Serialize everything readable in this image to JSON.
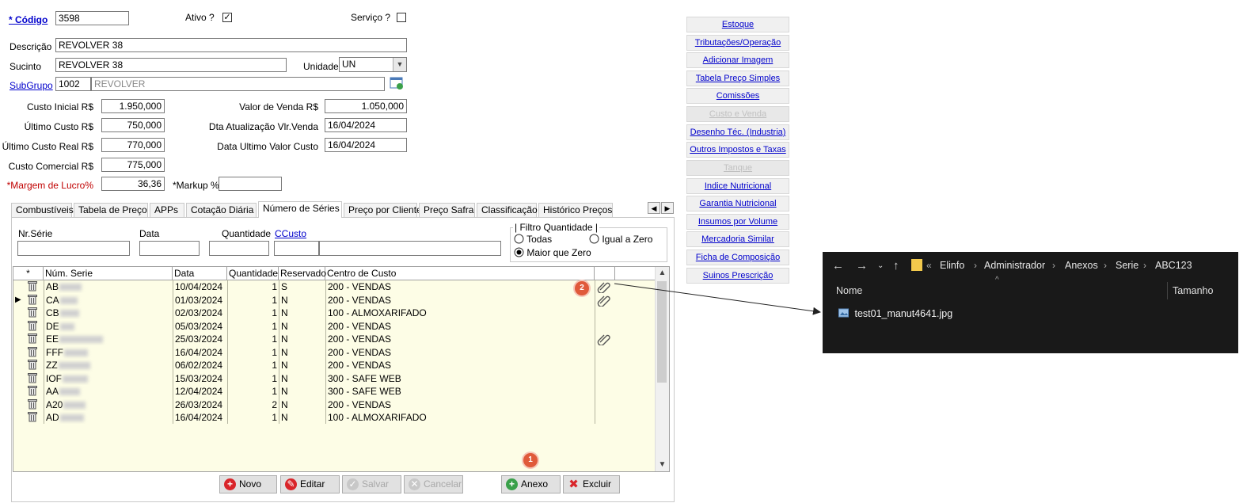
{
  "form": {
    "codigo_label": "* Código",
    "codigo_value": "3598",
    "ativo_label": "Ativo ?",
    "ativo_checked": "✓",
    "servico_label": "Serviço ?",
    "descricao_label": "Descrição",
    "descricao_value": "REVOLVER 38",
    "sucinto_label": "Sucinto",
    "sucinto_value": "REVOLVER 38",
    "unidade_label": "Unidade",
    "unidade_value": "UN",
    "subgrupo_label": "SubGrupo",
    "subgrupo_code": "1002",
    "subgrupo_name": "REVOLVER",
    "custo_inicial_label": "Custo Inicial R$",
    "custo_inicial_value": "1.950,000",
    "ultimo_custo_label": "Último Custo R$",
    "ultimo_custo_value": "750,000",
    "ultimo_custo_real_label": "Último Custo Real R$",
    "ultimo_custo_real_value": "770,000",
    "custo_comercial_label": "Custo Comercial R$",
    "custo_comercial_value": "775,000",
    "margem_label": "*Margem de Lucro%",
    "margem_value": "36,36",
    "markup_label": "*Markup %",
    "markup_value": "",
    "valor_venda_label": "Valor de Venda R$",
    "valor_venda_value": "1.050,000",
    "dta_atualizacao_label": "Dta Atualização Vlr.Venda",
    "dta_atualizacao_value": "16/04/2024",
    "data_ultimo_custo_label": "Data Ultimo Valor Custo",
    "data_ultimo_custo_value": "16/04/2024"
  },
  "side_buttons": [
    {
      "label": "Estoque",
      "disabled": false
    },
    {
      "label": "Tributações/Operação",
      "disabled": false
    },
    {
      "label": "Adicionar Imagem",
      "disabled": false
    },
    {
      "label": "Tabela Preço Simples",
      "disabled": false
    },
    {
      "label": "Comissões",
      "disabled": false
    },
    {
      "label": "Custo e Venda",
      "disabled": true
    },
    {
      "label": "Desenho Téc. (Industria)",
      "disabled": false
    },
    {
      "label": "Outros Impostos e Taxas",
      "disabled": false
    },
    {
      "label": "Tanque",
      "disabled": true
    },
    {
      "label": "Indice Nutricional",
      "disabled": false
    },
    {
      "label": "Garantia Nutricional",
      "disabled": false
    },
    {
      "label": "Insumos por Volume",
      "disabled": false
    },
    {
      "label": "Mercadoria Similar",
      "disabled": false
    },
    {
      "label": "Ficha de Composição",
      "disabled": false
    },
    {
      "label": "Suinos Prescrição",
      "disabled": false
    }
  ],
  "tabs": [
    {
      "label": "Combustíveis"
    },
    {
      "label": "Tabela de Preço"
    },
    {
      "label": "APPs"
    },
    {
      "label": "Cotação Diária"
    },
    {
      "label": "Número de Séries"
    },
    {
      "label": "Preço por Cliente"
    },
    {
      "label": "Preço Safra"
    },
    {
      "label": "Classificação"
    },
    {
      "label": "Histórico Preços"
    }
  ],
  "filters": {
    "nr_serie_label": "Nr.Série",
    "data_label": "Data",
    "quantidade_label": "Quantidade",
    "ccusto_label": "CCusto",
    "filtro_title": "Filtro Quantidade",
    "opt_todas": "Todas",
    "opt_igual_zero": "Igual a Zero",
    "opt_maior_zero": "Maior que Zero"
  },
  "grid": {
    "columns": [
      "*",
      "Núm. Serie",
      "Data",
      "Quantidade",
      "Reservado",
      "Centro de Custo"
    ],
    "rows": [
      {
        "serie": "AB",
        "data": "10/04/2024",
        "qtd": "1",
        "res": "S",
        "cc": "200 - VENDAS",
        "clip": true
      },
      {
        "serie": "CA",
        "data": "01/03/2024",
        "qtd": "1",
        "res": "N",
        "cc": "200 - VENDAS",
        "clip": true
      },
      {
        "serie": "CB",
        "data": "02/03/2024",
        "qtd": "1",
        "res": "N",
        "cc": "100 - ALMOXARIFADO",
        "clip": false
      },
      {
        "serie": "DE",
        "data": "05/03/2024",
        "qtd": "1",
        "res": "N",
        "cc": "200 - VENDAS",
        "clip": false
      },
      {
        "serie": "EE",
        "data": "25/03/2024",
        "qtd": "1",
        "res": "N",
        "cc": "200 - VENDAS",
        "clip": true
      },
      {
        "serie": "FFF",
        "data": "16/04/2024",
        "qtd": "1",
        "res": "N",
        "cc": "200 - VENDAS",
        "clip": false
      },
      {
        "serie": "ZZ",
        "data": "06/02/2024",
        "qtd": "1",
        "res": "N",
        "cc": "200 - VENDAS",
        "clip": false
      },
      {
        "serie": "IOF",
        "data": "15/03/2024",
        "qtd": "1",
        "res": "N",
        "cc": "300 - SAFE WEB",
        "clip": false
      },
      {
        "serie": "AA",
        "data": "12/04/2024",
        "qtd": "1",
        "res": "N",
        "cc": "300 - SAFE WEB",
        "clip": false
      },
      {
        "serie": "A20",
        "data": "26/03/2024",
        "qtd": "2",
        "res": "N",
        "cc": "200 - VENDAS",
        "clip": false
      },
      {
        "serie": "AD",
        "data": "16/04/2024",
        "qtd": "1",
        "res": "N",
        "cc": "100 - ALMOXARIFADO",
        "clip": false
      }
    ]
  },
  "bottom_buttons": {
    "novo": "Novo",
    "editar": "Editar",
    "salvar": "Salvar",
    "cancelar": "Cancelar",
    "anexo": "Anexo",
    "excluir": "Excluir"
  },
  "badges": {
    "one": "1",
    "two": "2"
  },
  "explorer": {
    "breadcrumb": [
      "Elinfo",
      "Administrador",
      "Anexos",
      "Serie",
      "ABC123"
    ],
    "col_nome": "Nome",
    "col_tamanho": "Tamanho",
    "file_name": "test01_manut4641.jpg"
  },
  "colors": {
    "accent_link": "#0000cc",
    "grid_bg": "#fdfde6",
    "badge": "#e05a3a",
    "explorer_bg": "#191919"
  }
}
